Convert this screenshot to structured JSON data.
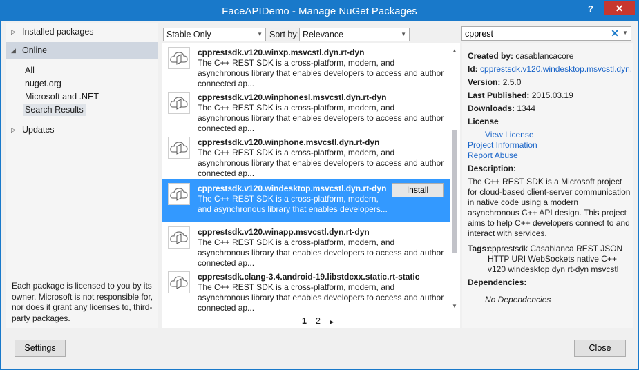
{
  "window": {
    "title": "FaceAPIDemo - Manage NuGet Packages",
    "help": "?",
    "close_glyph": "✕"
  },
  "sidebar": {
    "installed": "Installed packages",
    "online": "Online",
    "items": [
      "All",
      "nuget.org",
      "Microsoft and .NET",
      "Search Results"
    ],
    "updates": "Updates",
    "license_note": "Each package is licensed to you by its owner. Microsoft is not responsible for, nor does it grant any licenses to, third-party packages."
  },
  "filters": {
    "stability": "Stable Only",
    "sort_label": "Sort by:",
    "sort_value": "Relevance"
  },
  "search": {
    "value": "cpprest"
  },
  "packages": [
    {
      "name": "cpprestsdk.v120.winxp.msvcstl.dyn.rt-dyn",
      "desc": "The C++ REST SDK is a cross-platform, modern, and asynchronous library that enables developers to access and author connected ap..."
    },
    {
      "name": "cpprestsdk.v120.winphonesl.msvcstl.dyn.rt-dyn",
      "desc": "The C++ REST SDK is a cross-platform, modern, and asynchronous library that enables developers to access and author connected ap..."
    },
    {
      "name": "cpprestsdk.v120.winphone.msvcstl.dyn.rt-dyn",
      "desc": "The C++ REST SDK is a cross-platform, modern, and asynchronous library that enables developers to access and author connected ap..."
    },
    {
      "name": "cpprestsdk.v120.windesktop.msvcstl.dyn.rt-dyn",
      "desc": "The C++ REST SDK is a cross-platform, modern, and asynchronous library that enables developers..."
    },
    {
      "name": "cpprestsdk.v120.winapp.msvcstl.dyn.rt-dyn",
      "desc": "The C++ REST SDK is a cross-platform, modern, and asynchronous library that enables developers to access and author connected ap..."
    },
    {
      "name": "cpprestsdk.clang-3.4.android-19.libstdcxx.static.rt-static",
      "desc": "The C++ REST SDK is a cross-platform, modern, and asynchronous library that enables developers to access and author connected ap..."
    }
  ],
  "install_label": "Install",
  "pager": {
    "page1": "1",
    "page2": "2",
    "next": "▸"
  },
  "details": {
    "created_by_label": "Created by:",
    "created_by": "casablancacore",
    "id_label": "Id:",
    "id": "cpprestsdk.v120.windesktop.msvcstl.dyn.",
    "version_label": "Version:",
    "version": "2.5.0",
    "published_label": "Last Published:",
    "published": "2015.03.19",
    "downloads_label": "Downloads:",
    "downloads": "1344",
    "license_label": "License",
    "view_license": "View License",
    "project_info": "Project Information",
    "report_abuse": "Report Abuse",
    "description_label": "Description:",
    "description": "The C++ REST SDK is a Microsoft project for cloud-based client-server communication in native code using a modern asynchronous C++ API design. This project aims to help C++ developers connect to and interact with services.",
    "tags_label": "Tags:",
    "tags_line1": "cpprestsdk Casablanca REST JSON",
    "tags_line2": "HTTP URI WebSockets native C++",
    "tags_line3": "v120 windesktop dyn rt-dyn msvcstl",
    "dependencies_label": "Dependencies:",
    "no_dependencies": "No Dependencies"
  },
  "buttons": {
    "settings": "Settings",
    "close": "Close"
  },
  "colors": {
    "accent": "#1979ca",
    "selection": "#3399ff",
    "link": "#1964c8"
  }
}
